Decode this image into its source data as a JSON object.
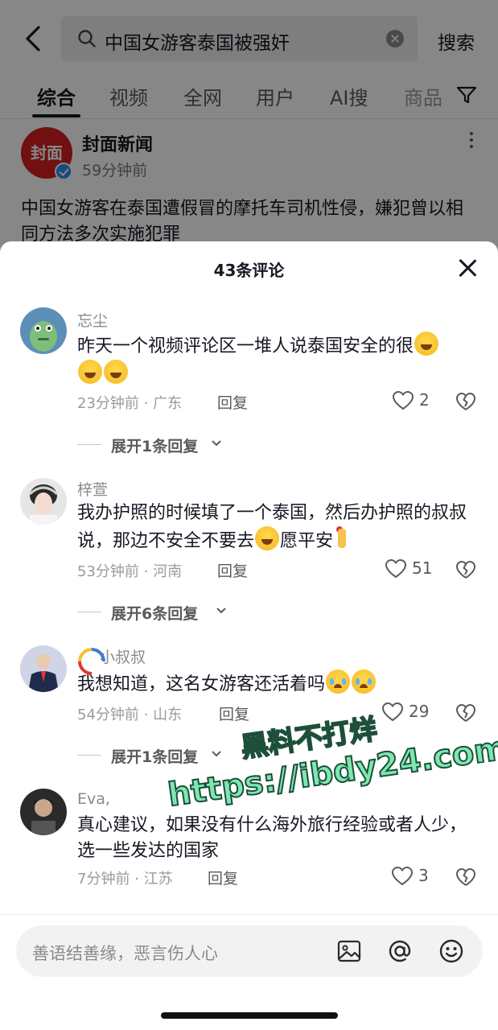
{
  "search": {
    "query": "中国女游客泰国被强奸",
    "button_label": "搜索"
  },
  "tabs": [
    "综合",
    "视频",
    "全网",
    "用户",
    "AI搜",
    "商品"
  ],
  "post": {
    "avatar_text": "封面",
    "author": "封面新闻",
    "time": "59分钟前",
    "text": "中国女游客在泰国遭假冒的摩托车司机性侵，嫌犯曾以相同方法多次实施犯罪"
  },
  "comments_sheet": {
    "title": "43条评论",
    "comments": [
      {
        "name": "忘尘",
        "text": "昨天一个视频评论区一堆人说泰国安全的很",
        "time_location": "23分钟前 · 广东",
        "reply_label": "回复",
        "likes": "2",
        "expand_label": "展开1条回复"
      },
      {
        "name": "梓萱",
        "text_1": "我办护照的时候填了一个泰国，然后办护照的叔叔说，那边不安全不要去",
        "text_2": "愿平安",
        "time_location": "53分钟前 · 河南",
        "reply_label": "回复",
        "likes": "51",
        "expand_label": "展开6条回复"
      },
      {
        "name": "小叔叔",
        "text": "我想知道，这名女游客还活着吗",
        "time_location": "54分钟前 · 山东",
        "reply_label": "回复",
        "likes": "29",
        "expand_label": "展开1条回复"
      },
      {
        "name": "Eva,",
        "text": "真心建议，如果没有什么海外旅行经验或者人少，选一些发达的国家",
        "time_location": "7分钟前 · 江苏",
        "reply_label": "回复",
        "likes": "3"
      }
    ]
  },
  "watermark": {
    "line1": "黑料不打烊",
    "line2": "https://ibdy24.com"
  },
  "input": {
    "placeholder": "善语结善缘，恶言伤人心"
  },
  "colors": {
    "accent": "#161823",
    "brand_red": "#d41f1f",
    "watermark": "#7ce8b0"
  }
}
